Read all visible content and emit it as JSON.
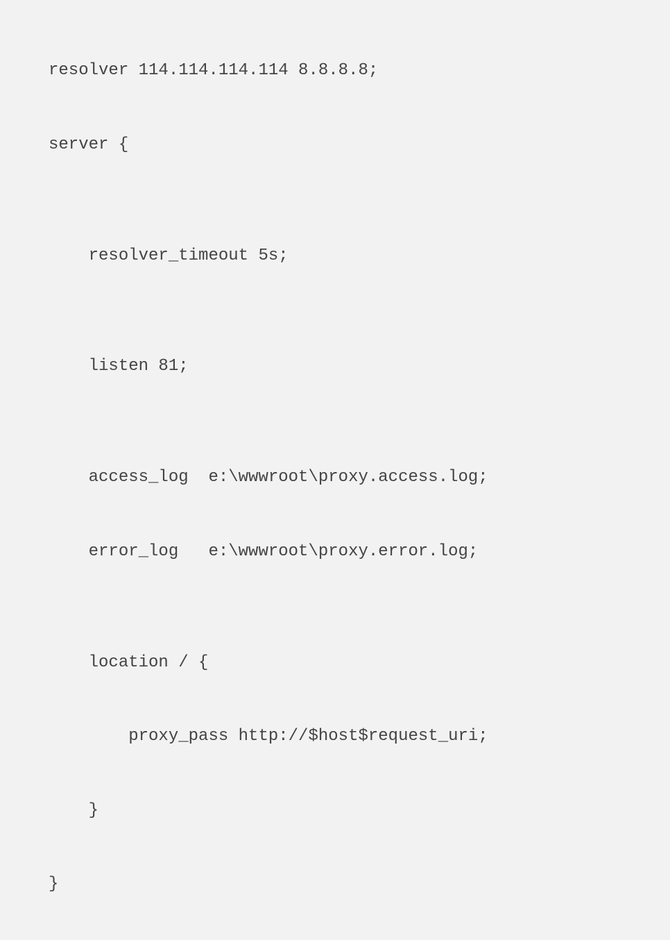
{
  "code": {
    "line1": "resolver 114.114.114.114 8.8.8.8;",
    "line2": "server {",
    "line3": "",
    "line4": "    resolver_timeout 5s;",
    "line5": "",
    "line6": "    listen 81;",
    "line7": "",
    "line8": "    access_log  e:\\wwwroot\\proxy.access.log;",
    "line9": "    error_log   e:\\wwwroot\\proxy.error.log;",
    "line10": "",
    "line11": "    location / {",
    "line12": "        proxy_pass http://$host$request_uri;",
    "line13": "    }",
    "line14": "}"
  }
}
